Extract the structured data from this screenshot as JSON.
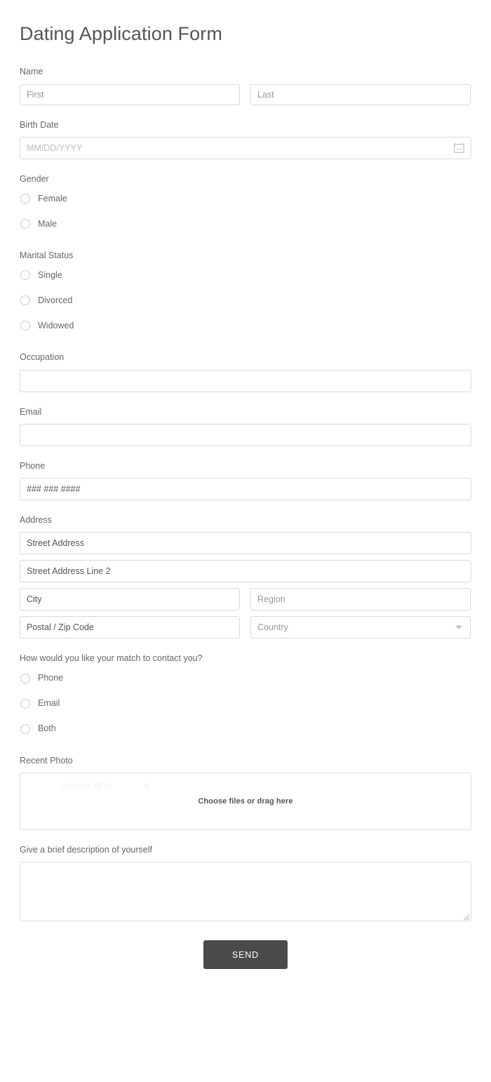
{
  "form": {
    "title": "Dating Application Form",
    "name": {
      "label": "Name",
      "first_placeholder": "First",
      "last_placeholder": "Last",
      "first_value": "",
      "last_value": ""
    },
    "birth_date": {
      "label": "Birth Date",
      "placeholder": "MM/DD/YYYY",
      "value": "",
      "icon": "calendar-icon"
    },
    "gender": {
      "label": "Gender",
      "options": [
        {
          "label": "Female",
          "selected": false
        },
        {
          "label": "Male",
          "selected": false
        }
      ]
    },
    "marital_status": {
      "label": "Marital Status",
      "options": [
        {
          "label": "Single",
          "selected": false
        },
        {
          "label": "Divorced",
          "selected": false
        },
        {
          "label": "Widowed",
          "selected": false
        }
      ]
    },
    "occupation": {
      "label": "Occupation",
      "placeholder": "",
      "value": ""
    },
    "email": {
      "label": "Email",
      "placeholder": "",
      "value": ""
    },
    "phone": {
      "label": "Phone",
      "placeholder": "### ### ####",
      "value": ""
    },
    "address": {
      "label": "Address",
      "street1_placeholder": "Street Address",
      "street2_placeholder": "Street Address Line 2",
      "city_placeholder": "City",
      "region_placeholder": "Region",
      "postal_placeholder": "Postal / Zip Code",
      "country_placeholder": "Country",
      "street1_value": "",
      "street2_value": "",
      "city_value": "",
      "region_value": "",
      "postal_value": "",
      "country_value": "",
      "country_icon": "chevron-down-icon"
    },
    "contact_preference": {
      "label": "How would you like your match to contact you?",
      "options": [
        {
          "label": "Phone",
          "selected": false
        },
        {
          "label": "Email",
          "selected": false
        },
        {
          "label": "Both",
          "selected": false
        }
      ]
    },
    "recent_photo": {
      "label": "Recent Photo",
      "dropzone_text": "Choose files or drag here"
    },
    "description": {
      "label": "Give a brief description of yourself",
      "placeholder": "",
      "value": ""
    },
    "submit": {
      "label": "SEND"
    }
  },
  "colors": {
    "page_background": "#ffffff",
    "title_text": "#555555",
    "label_text": "#666666",
    "input_border": "#d9d9d9",
    "placeholder_light": "#bdbdbd",
    "placeholder_medium": "#999999",
    "placeholder_dark": "#555555",
    "radio_border": "#cccccc",
    "submit_background": "#4a4a4a",
    "submit_text": "#ffffff"
  }
}
